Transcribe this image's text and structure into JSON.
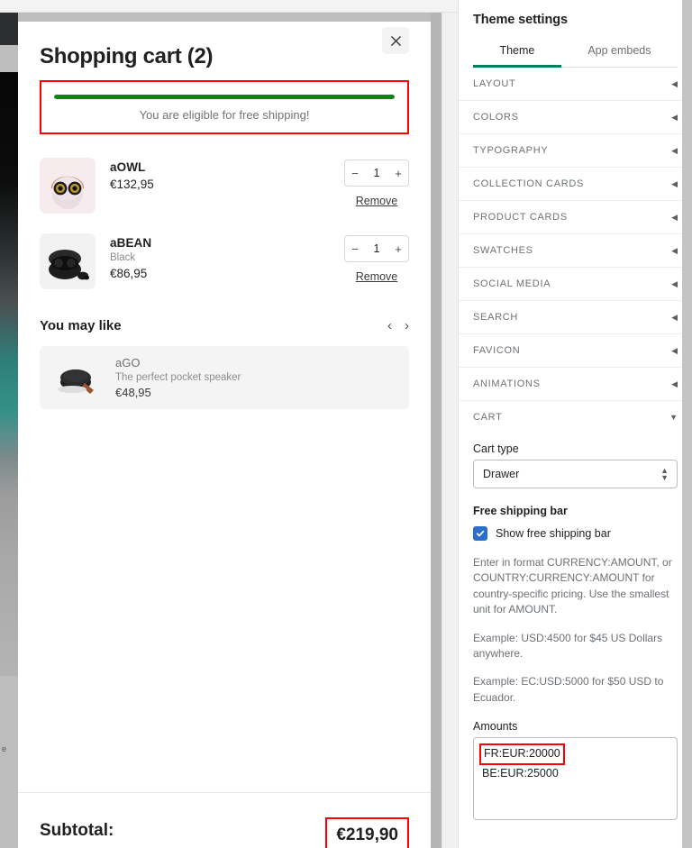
{
  "cart": {
    "title": "Shopping cart (2)",
    "close_label": "Close",
    "free_shipping": {
      "message": "You are eligible for free shipping!",
      "progress_percent": 100,
      "bar_color": "#088718",
      "highlight_color": "#ff0000"
    },
    "items": [
      {
        "name": "aOWL",
        "variant": "",
        "price": "€132,95",
        "quantity": "1",
        "decrement_label": "−",
        "increment_label": "+",
        "remove_label": "Remove",
        "image_name": "owl-headphones-thumbnail"
      },
      {
        "name": "aBEAN",
        "variant": "Black",
        "price": "€86,95",
        "quantity": "1",
        "decrement_label": "−",
        "increment_label": "+",
        "remove_label": "Remove",
        "image_name": "bean-earbuds-thumbnail"
      }
    ],
    "recommendations": {
      "title": "You may like",
      "prev_label": "‹",
      "next_label": "›",
      "items": [
        {
          "name": "aGO",
          "description": "The perfect pocket speaker",
          "price": "€48,95",
          "image_name": "go-speaker-thumbnail"
        }
      ]
    },
    "footer": {
      "subtotal_label": "Subtotal:",
      "subtotal_value": "€219,90",
      "highlight_color": "#ff0000"
    }
  },
  "settings": {
    "title": "Theme settings",
    "tabs": [
      {
        "label": "Theme",
        "active": true
      },
      {
        "label": "App embeds",
        "active": false
      }
    ],
    "active_tab_color": "#008060",
    "sections": [
      {
        "label": "LAYOUT",
        "expanded": false,
        "caret": "◀"
      },
      {
        "label": "COLORS",
        "expanded": false,
        "caret": "◀"
      },
      {
        "label": "TYPOGRAPHY",
        "expanded": false,
        "caret": "◀"
      },
      {
        "label": "COLLECTION CARDS",
        "expanded": false,
        "caret": "◀"
      },
      {
        "label": "PRODUCT CARDS",
        "expanded": false,
        "caret": "◀"
      },
      {
        "label": "SWATCHES",
        "expanded": false,
        "caret": "◀"
      },
      {
        "label": "SOCIAL MEDIA",
        "expanded": false,
        "caret": "◀"
      },
      {
        "label": "SEARCH",
        "expanded": false,
        "caret": "◀"
      },
      {
        "label": "FAVICON",
        "expanded": false,
        "caret": "◀"
      },
      {
        "label": "ANIMATIONS",
        "expanded": false,
        "caret": "◀"
      },
      {
        "label": "CART",
        "expanded": true,
        "caret": "▼"
      }
    ],
    "cart_section": {
      "cart_type_label": "Cart type",
      "cart_type_value": "Drawer",
      "select_arrows": "⬍",
      "free_shipping_heading": "Free shipping bar",
      "show_bar_label": "Show free shipping bar",
      "show_bar_checked": true,
      "checkbox_color": "#2c6ecb",
      "help_1": "Enter in format CURRENCY:AMOUNT, or COUNTRY:CURRENCY:AMOUNT for country-specific pricing. Use the smallest unit for AMOUNT.",
      "help_2": "Example: USD:4500 for $45 US Dollars anywhere.",
      "help_3": "Example: EC:USD:5000 for $50 USD to Ecuador.",
      "amounts_label": "Amounts",
      "amounts_lines": [
        {
          "text": "FR:EUR:20000",
          "highlighted": true
        },
        {
          "text": "BE:EUR:25000",
          "highlighted": false
        }
      ],
      "highlight_color": "#ff0000"
    }
  },
  "preview": {
    "footer_fragment": "e"
  }
}
